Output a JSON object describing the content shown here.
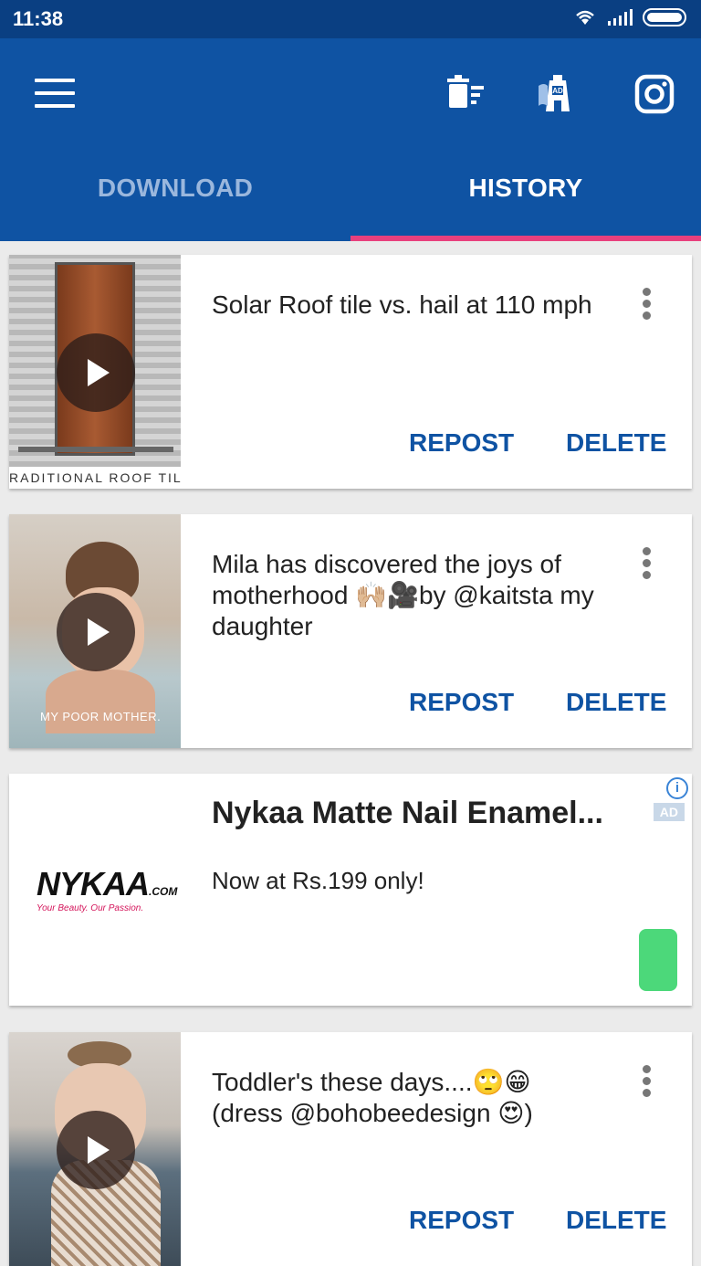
{
  "status_bar": {
    "time": "11:38"
  },
  "tabs": [
    {
      "label": "DOWNLOAD"
    },
    {
      "label": "HISTORY"
    }
  ],
  "toolbar_icons": [
    "menu-icon",
    "clear-history-icon",
    "remove-ads-icon",
    "instagram-icon"
  ],
  "cards": [
    {
      "title": "Solar Roof tile vs. hail at 110 mph",
      "thumb_caption": "RADITIONAL ROOF TIL",
      "repost_label": "REPOST",
      "delete_label": "DELETE"
    },
    {
      "title": "Mila has discovered the joys of motherhood 🙌🏼🎥by @kaitsta my daughter",
      "thumb_caption": "MY POOR MOTHER.",
      "repost_label": "REPOST",
      "delete_label": "DELETE"
    },
    {
      "title": "Toddler's these days....🙄😁 (dress @bohobeedesign 😍)",
      "repost_label": "REPOST",
      "delete_label": "DELETE"
    }
  ],
  "ad": {
    "title": "Nykaa Matte Nail Enamel...",
    "subtitle": "Now at Rs.199 only!",
    "badge": "AD",
    "info": "i",
    "logo_text": "NYKAA",
    "logo_suffix": ".COM",
    "logo_tagline": "Your Beauty. Our Passion."
  },
  "colors": {
    "app_bar": "#0f53a3",
    "status_bar": "#0a3f82",
    "tab_indicator": "#e8407d",
    "button_text": "#0f53a3",
    "ad_cta": "#4cd87a"
  }
}
